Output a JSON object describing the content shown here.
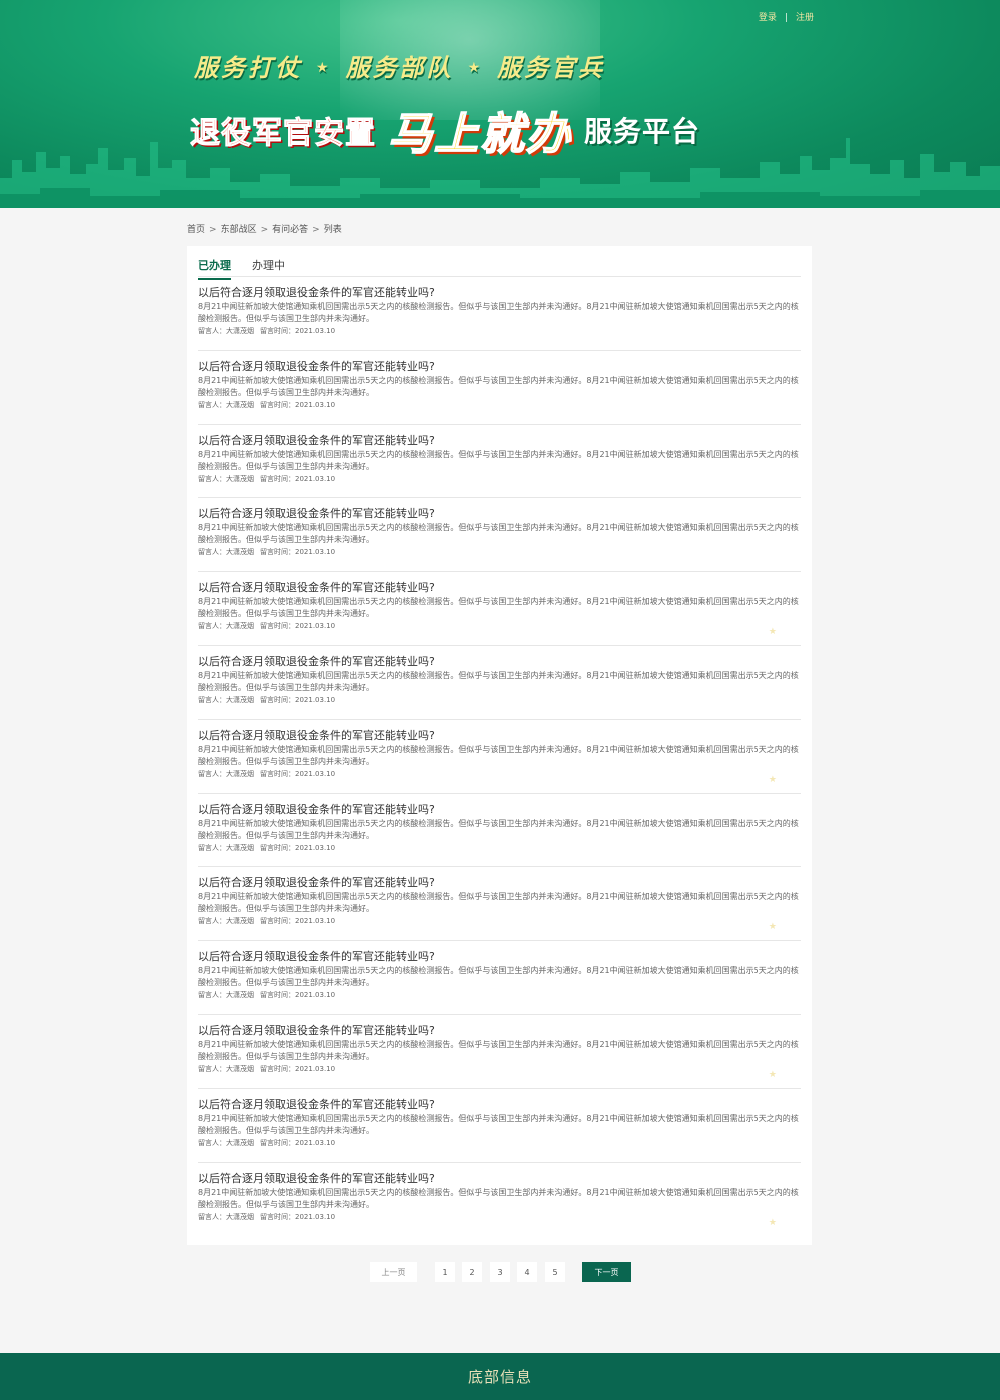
{
  "header": {
    "login_label": "登录",
    "separator": "|",
    "register_label": "注册",
    "slogans": [
      "服务打仗",
      "服务部队",
      "服务官兵"
    ],
    "star_glyph": "★",
    "headline_part1": "退役军官安置",
    "headline_part2": "马上就办",
    "headline_part3": "服务平台"
  },
  "breadcrumb": {
    "items": [
      "首页",
      "东部战区",
      "有问必答",
      "列表"
    ],
    "separator": ">"
  },
  "tabs": [
    {
      "label": "已办理",
      "active": true
    },
    {
      "label": "办理中",
      "active": false
    }
  ],
  "items": [
    {
      "title": "以后符合逐月领取退役金条件的军官还能转业吗?",
      "summary": "8月21中闻驻新加坡大使馆通知乘机回国需出示5天之内的核酸检测报告。但似乎与该国卫生部内并未沟通好。8月21中闻驻新加坡大使馆通知乘机回国需出示5天之内的核酸检测报告。但似乎与该国卫生部内并未沟通好。",
      "author_label": "留言人：",
      "author": "大潇茂烟",
      "time_label": "留言时间：",
      "time": "2021.03.10",
      "starred": false
    },
    {
      "title": "以后符合逐月领取退役金条件的军官还能转业吗?",
      "summary": "8月21中闻驻新加坡大使馆通知乘机回国需出示5天之内的核酸检测报告。但似乎与该国卫生部内并未沟通好。8月21中闻驻新加坡大使馆通知乘机回国需出示5天之内的核酸检测报告。但似乎与该国卫生部内并未沟通好。",
      "author_label": "留言人：",
      "author": "大潇茂烟",
      "time_label": "留言时间：",
      "time": "2021.03.10",
      "starred": false
    },
    {
      "title": "以后符合逐月领取退役金条件的军官还能转业吗?",
      "summary": "8月21中闻驻新加坡大使馆通知乘机回国需出示5天之内的核酸检测报告。但似乎与该国卫生部内并未沟通好。8月21中闻驻新加坡大使馆通知乘机回国需出示5天之内的核酸检测报告。但似乎与该国卫生部内并未沟通好。",
      "author_label": "留言人：",
      "author": "大潇茂烟",
      "time_label": "留言时间：",
      "time": "2021.03.10",
      "starred": false
    },
    {
      "title": "以后符合逐月领取退役金条件的军官还能转业吗?",
      "summary": "8月21中闻驻新加坡大使馆通知乘机回国需出示5天之内的核酸检测报告。但似乎与该国卫生部内并未沟通好。8月21中闻驻新加坡大使馆通知乘机回国需出示5天之内的核酸检测报告。但似乎与该国卫生部内并未沟通好。",
      "author_label": "留言人：",
      "author": "大潇茂烟",
      "time_label": "留言时间：",
      "time": "2021.03.10",
      "starred": false
    },
    {
      "title": "以后符合逐月领取退役金条件的军官还能转业吗?",
      "summary": "8月21中闻驻新加坡大使馆通知乘机回国需出示5天之内的核酸检测报告。但似乎与该国卫生部内并未沟通好。8月21中闻驻新加坡大使馆通知乘机回国需出示5天之内的核酸检测报告。但似乎与该国卫生部内并未沟通好。",
      "author_label": "留言人：",
      "author": "大潇茂烟",
      "time_label": "留言时间：",
      "time": "2021.03.10",
      "starred": true
    },
    {
      "title": "以后符合逐月领取退役金条件的军官还能转业吗?",
      "summary": "8月21中闻驻新加坡大使馆通知乘机回国需出示5天之内的核酸检测报告。但似乎与该国卫生部内并未沟通好。8月21中闻驻新加坡大使馆通知乘机回国需出示5天之内的核酸检测报告。但似乎与该国卫生部内并未沟通好。",
      "author_label": "留言人：",
      "author": "大潇茂烟",
      "time_label": "留言时间：",
      "time": "2021.03.10",
      "starred": false
    },
    {
      "title": "以后符合逐月领取退役金条件的军官还能转业吗?",
      "summary": "8月21中闻驻新加坡大使馆通知乘机回国需出示5天之内的核酸检测报告。但似乎与该国卫生部内并未沟通好。8月21中闻驻新加坡大使馆通知乘机回国需出示5天之内的核酸检测报告。但似乎与该国卫生部内并未沟通好。",
      "author_label": "留言人：",
      "author": "大潇茂烟",
      "time_label": "留言时间：",
      "time": "2021.03.10",
      "starred": true
    },
    {
      "title": "以后符合逐月领取退役金条件的军官还能转业吗?",
      "summary": "8月21中闻驻新加坡大使馆通知乘机回国需出示5天之内的核酸检测报告。但似乎与该国卫生部内并未沟通好。8月21中闻驻新加坡大使馆通知乘机回国需出示5天之内的核酸检测报告。但似乎与该国卫生部内并未沟通好。",
      "author_label": "留言人：",
      "author": "大潇茂烟",
      "time_label": "留言时间：",
      "time": "2021.03.10",
      "starred": false
    },
    {
      "title": "以后符合逐月领取退役金条件的军官还能转业吗?",
      "summary": "8月21中闻驻新加坡大使馆通知乘机回国需出示5天之内的核酸检测报告。但似乎与该国卫生部内并未沟通好。8月21中闻驻新加坡大使馆通知乘机回国需出示5天之内的核酸检测报告。但似乎与该国卫生部内并未沟通好。",
      "author_label": "留言人：",
      "author": "大潇茂烟",
      "time_label": "留言时间：",
      "time": "2021.03.10",
      "starred": true
    },
    {
      "title": "以后符合逐月领取退役金条件的军官还能转业吗?",
      "summary": "8月21中闻驻新加坡大使馆通知乘机回国需出示5天之内的核酸检测报告。但似乎与该国卫生部内并未沟通好。8月21中闻驻新加坡大使馆通知乘机回国需出示5天之内的核酸检测报告。但似乎与该国卫生部内并未沟通好。",
      "author_label": "留言人：",
      "author": "大潇茂烟",
      "time_label": "留言时间：",
      "time": "2021.03.10",
      "starred": false
    },
    {
      "title": "以后符合逐月领取退役金条件的军官还能转业吗?",
      "summary": "8月21中闻驻新加坡大使馆通知乘机回国需出示5天之内的核酸检测报告。但似乎与该国卫生部内并未沟通好。8月21中闻驻新加坡大使馆通知乘机回国需出示5天之内的核酸检测报告。但似乎与该国卫生部内并未沟通好。",
      "author_label": "留言人：",
      "author": "大潇茂烟",
      "time_label": "留言时间：",
      "time": "2021.03.10",
      "starred": true
    },
    {
      "title": "以后符合逐月领取退役金条件的军官还能转业吗?",
      "summary": "8月21中闻驻新加坡大使馆通知乘机回国需出示5天之内的核酸检测报告。但似乎与该国卫生部内并未沟通好。8月21中闻驻新加坡大使馆通知乘机回国需出示5天之内的核酸检测报告。但似乎与该国卫生部内并未沟通好。",
      "author_label": "留言人：",
      "author": "大潇茂烟",
      "time_label": "留言时间：",
      "time": "2021.03.10",
      "starred": false
    },
    {
      "title": "以后符合逐月领取退役金条件的军官还能转业吗?",
      "summary": "8月21中闻驻新加坡大使馆通知乘机回国需出示5天之内的核酸检测报告。但似乎与该国卫生部内并未沟通好。8月21中闻驻新加坡大使馆通知乘机回国需出示5天之内的核酸检测报告。但似乎与该国卫生部内并未沟通好。",
      "author_label": "留言人：",
      "author": "大潇茂烟",
      "time_label": "留言时间：",
      "time": "2021.03.10",
      "starred": true
    }
  ],
  "pagination": {
    "prev_label": "上一页",
    "pages": [
      "1",
      "2",
      "3",
      "4",
      "5"
    ],
    "current_page": "1",
    "next_label": "下一页"
  },
  "footer": {
    "text": "底部信息"
  },
  "colors": {
    "brand_green": "#0a6650",
    "accent_green": "#0a6b4c",
    "banner_green": "#17a471"
  }
}
